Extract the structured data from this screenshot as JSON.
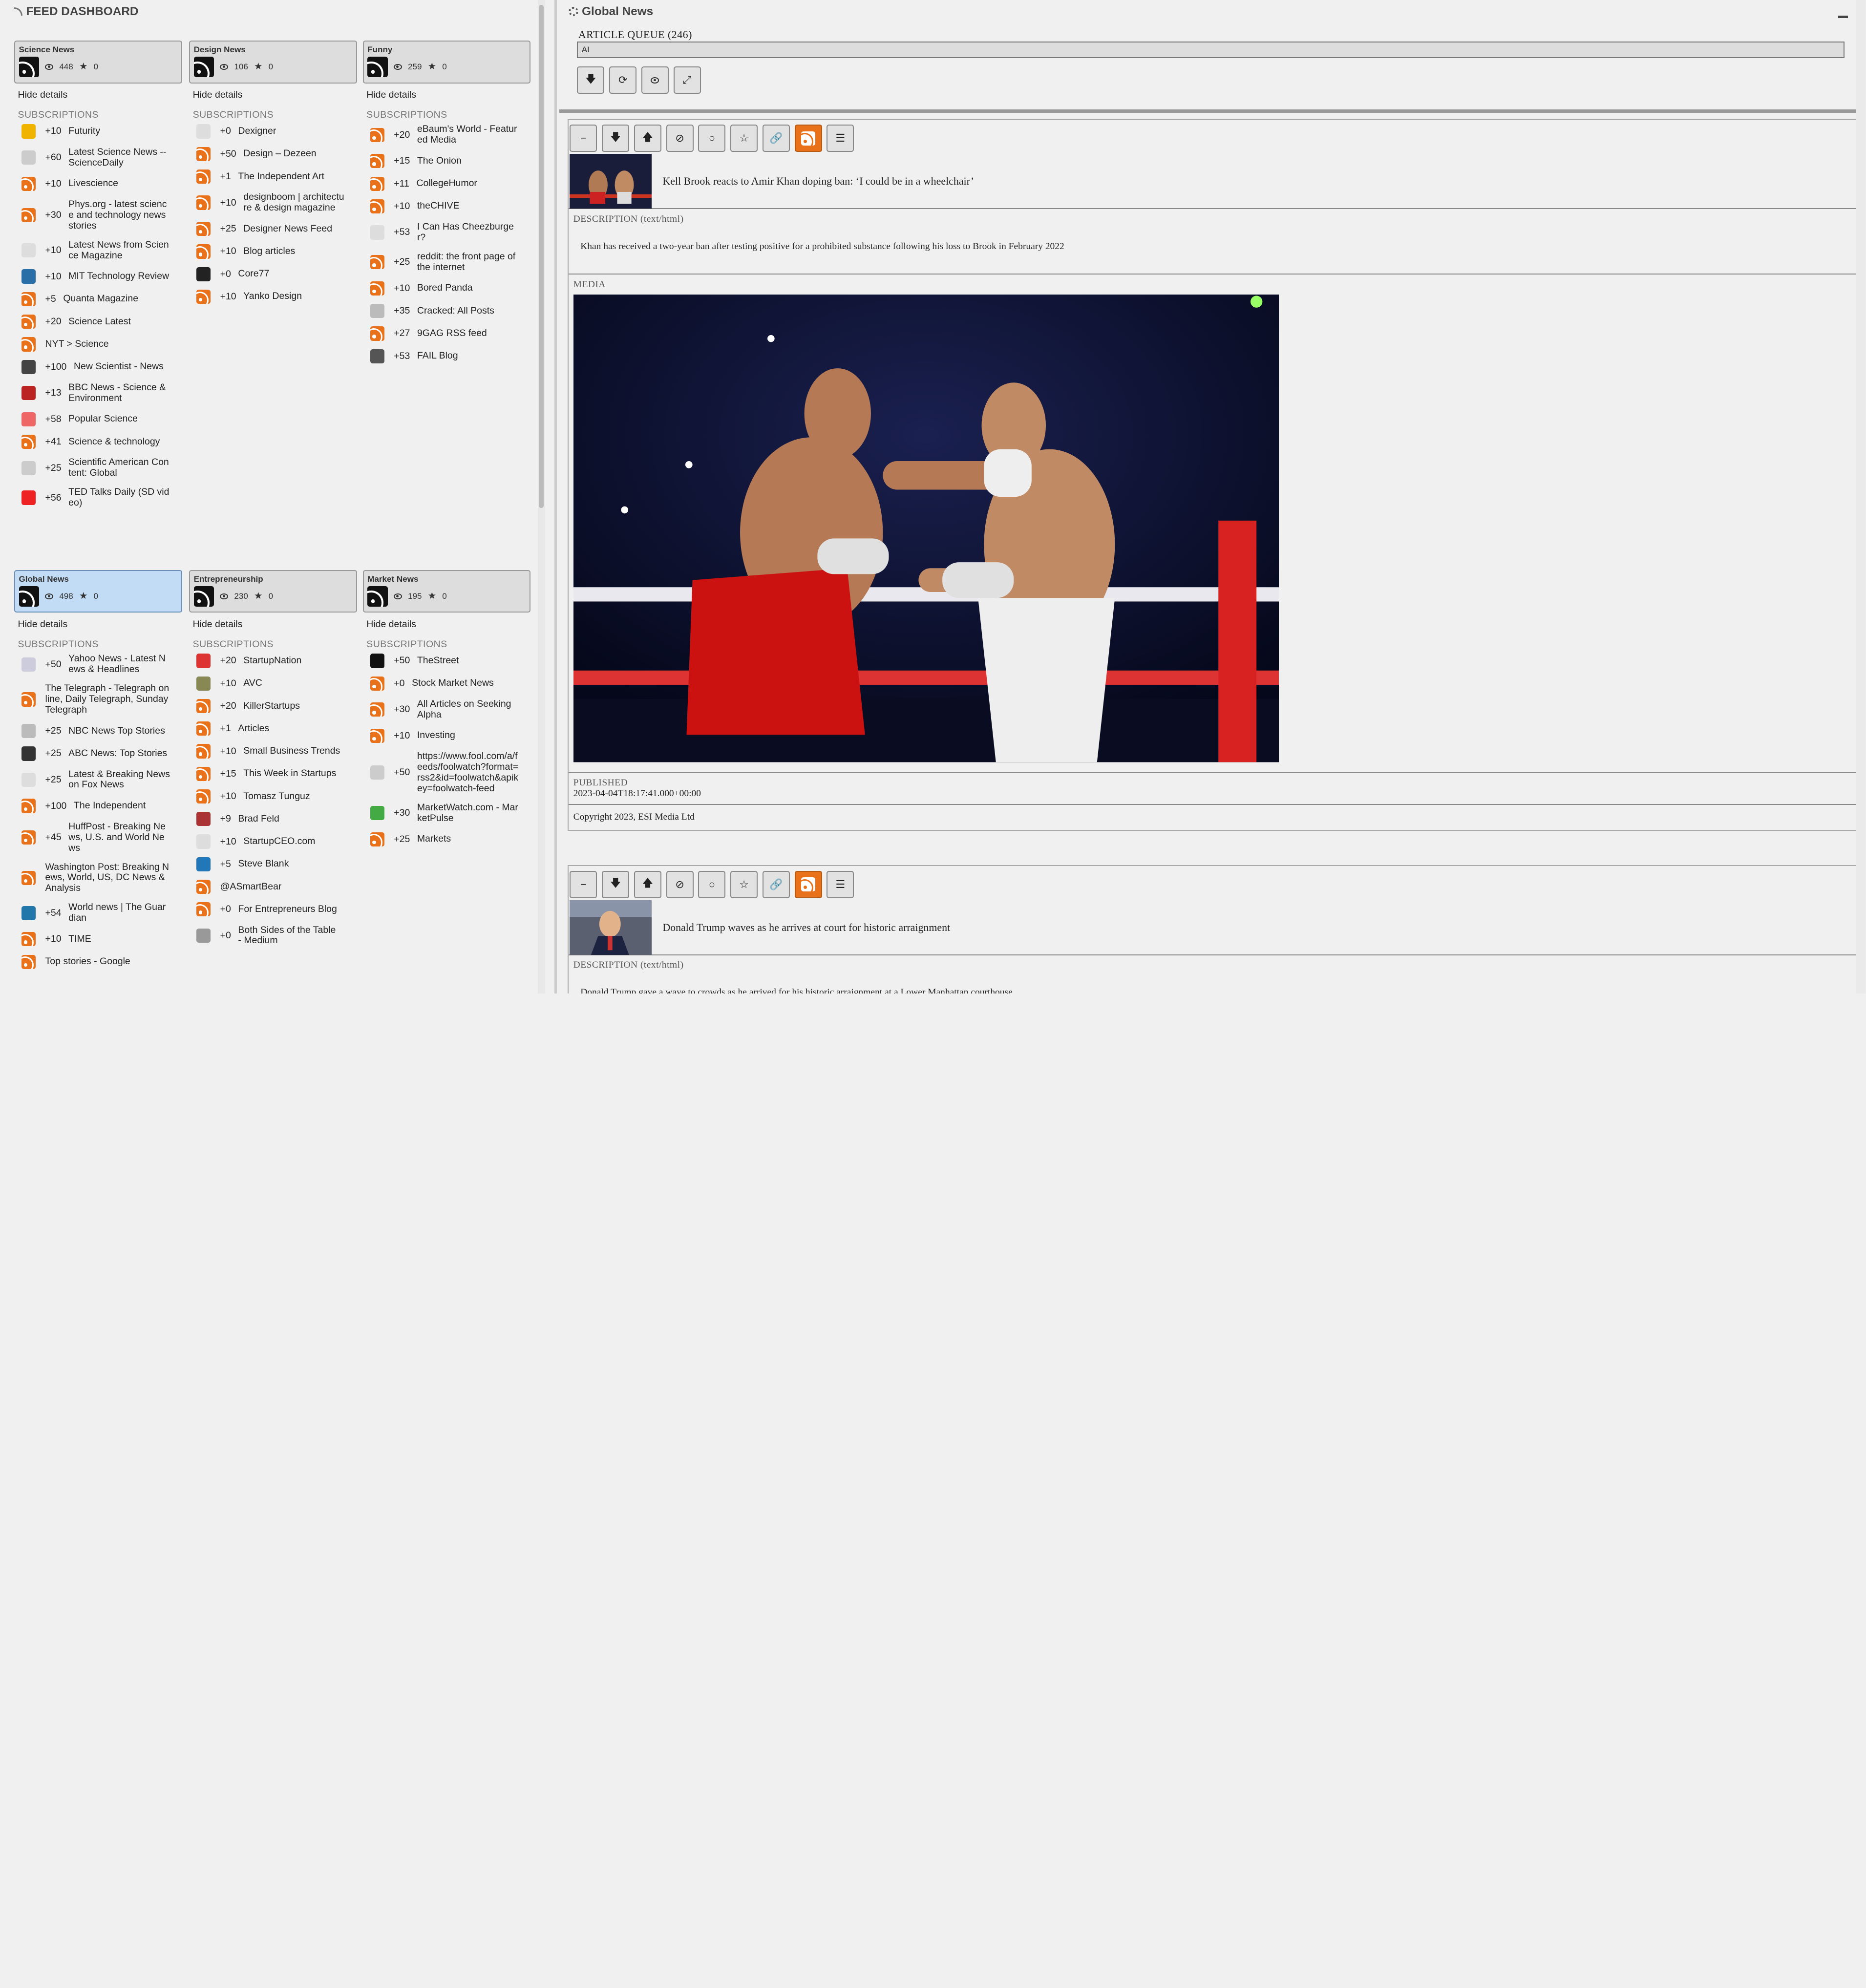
{
  "left": {
    "title": "FEED DASHBOARD",
    "hide_label": "Hide details",
    "subs_header": "SUBSCRIPTIONS",
    "columns": [
      {
        "name": "Science News",
        "views": "448",
        "stars": "0",
        "selected": false,
        "subs": [
          {
            "count": "+10",
            "name": "Futurity",
            "icon": "futurity-icon"
          },
          {
            "count": "+60",
            "name": "Latest Science News -- ScienceDaily",
            "icon": "sciencedaily-icon"
          },
          {
            "count": "+10",
            "name": "Livescience",
            "icon": "rss"
          },
          {
            "count": "+30",
            "name": "Phys.org - latest science and technology news stories",
            "icon": "rss"
          },
          {
            "count": "+10",
            "name": "Latest News from Science Magazine",
            "icon": "science-mag-icon"
          },
          {
            "count": "+10",
            "name": "MIT Technology Review",
            "icon": "mit-icon"
          },
          {
            "count": "+5",
            "name": "Quanta Magazine",
            "icon": "rss"
          },
          {
            "count": "+20",
            "name": "Science Latest",
            "icon": "rss"
          },
          {
            "count": "",
            "name": "NYT > Science",
            "icon": "rss"
          },
          {
            "count": "+100",
            "name": "New Scientist - News",
            "icon": "newscientist-icon"
          },
          {
            "count": "+13",
            "name": "BBC News - Science & Environment",
            "icon": "bbc-icon"
          },
          {
            "count": "+58",
            "name": "Popular Science",
            "icon": "popsci-icon"
          },
          {
            "count": "+41",
            "name": "Science & technology",
            "icon": "rss"
          },
          {
            "count": "+25",
            "name": "Scientific American Content: Global",
            "icon": "sciam-icon"
          },
          {
            "count": "+56",
            "name": "TED Talks Daily (SD video)",
            "icon": "ted-icon"
          }
        ]
      },
      {
        "name": "Design News",
        "views": "106",
        "stars": "0",
        "selected": false,
        "subs": [
          {
            "count": "+0",
            "name": "Dexigner",
            "icon": "dexigner-icon"
          },
          {
            "count": "+50",
            "name": "Design – Dezeen",
            "icon": "rss"
          },
          {
            "count": "+1",
            "name": "The Independent Art",
            "icon": "rss"
          },
          {
            "count": "+10",
            "name": "designboom | architecture & design magazine",
            "icon": "rss"
          },
          {
            "count": "+25",
            "name": "Designer News Feed",
            "icon": "rss"
          },
          {
            "count": "+10",
            "name": "Blog articles",
            "icon": "rss"
          },
          {
            "count": "+0",
            "name": "Core77",
            "icon": "core77-icon"
          },
          {
            "count": "+10",
            "name": "Yanko Design",
            "icon": "rss"
          }
        ]
      },
      {
        "name": "Funny",
        "views": "259",
        "stars": "0",
        "selected": false,
        "subs": [
          {
            "count": "+20",
            "name": "eBaum's World - Featured Media",
            "icon": "rss"
          },
          {
            "count": "+15",
            "name": "The Onion",
            "icon": "rss"
          },
          {
            "count": "+11",
            "name": "CollegeHumor",
            "icon": "rss"
          },
          {
            "count": "+10",
            "name": "theCHIVE",
            "icon": "rss"
          },
          {
            "count": "+53",
            "name": "I Can Has Cheezburger?",
            "icon": "cheezburger-icon"
          },
          {
            "count": "+25",
            "name": "reddit: the front page of the internet",
            "icon": "rss"
          },
          {
            "count": "+10",
            "name": "Bored Panda",
            "icon": "rss"
          },
          {
            "count": "+35",
            "name": "Cracked: All Posts",
            "icon": "cracked-icon"
          },
          {
            "count": "+27",
            "name": "9GAG RSS feed",
            "icon": "rss"
          },
          {
            "count": "+53",
            "name": "FAIL Blog",
            "icon": "failblog-icon"
          }
        ]
      },
      {
        "name": "Global News",
        "views": "498",
        "stars": "0",
        "selected": true,
        "subs": [
          {
            "count": "+50",
            "name": "Yahoo News - Latest News & Headlines",
            "icon": "yahoo-icon"
          },
          {
            "count": "",
            "name": "The Telegraph - Telegraph online, Daily Telegraph, Sunday Telegraph",
            "icon": "rss"
          },
          {
            "count": "+25",
            "name": "NBC News Top Stories",
            "icon": "nbc-icon"
          },
          {
            "count": "+25",
            "name": "ABC News: Top Stories",
            "icon": "abc-icon"
          },
          {
            "count": "+25",
            "name": "Latest & Breaking News on Fox News",
            "icon": "fox-icon"
          },
          {
            "count": "+100",
            "name": "The Independent",
            "icon": "rss"
          },
          {
            "count": "+45",
            "name": "HuffPost - Breaking News, U.S. and World News",
            "icon": "rss"
          },
          {
            "count": "",
            "name": "Washington Post: Breaking News, World, US, DC News & Analysis",
            "icon": "rss"
          },
          {
            "count": "+54",
            "name": "World news | The Guardian",
            "icon": "guardian-icon"
          },
          {
            "count": "+10",
            "name": "TIME",
            "icon": "rss"
          },
          {
            "count": "",
            "name": "Top stories - Google",
            "icon": "rss"
          }
        ]
      },
      {
        "name": "Entrepreneurship",
        "views": "230",
        "stars": "0",
        "selected": false,
        "subs": [
          {
            "count": "+20",
            "name": "StartupNation",
            "icon": "startupnation-icon"
          },
          {
            "count": "+10",
            "name": "AVC",
            "icon": "avc-icon"
          },
          {
            "count": "+20",
            "name": "KillerStartups",
            "icon": "rss"
          },
          {
            "count": "+1",
            "name": "Articles",
            "icon": "rss"
          },
          {
            "count": "+10",
            "name": "Small Business Trends",
            "icon": "rss"
          },
          {
            "count": "+15",
            "name": "This Week in Startups",
            "icon": "rss"
          },
          {
            "count": "+10",
            "name": "Tomasz Tunguz",
            "icon": "rss"
          },
          {
            "count": "+9",
            "name": "Brad Feld",
            "icon": "bradfeld-icon"
          },
          {
            "count": "+10",
            "name": "StartupCEO.com",
            "icon": "startupceo-icon"
          },
          {
            "count": "+5",
            "name": "Steve Blank",
            "icon": "wordpress-icon"
          },
          {
            "count": "",
            "name": "@ASmartBear",
            "icon": "rss"
          },
          {
            "count": "+0",
            "name": "For Entrepreneurs Blog",
            "icon": "rss"
          },
          {
            "count": "+0",
            "name": "Both Sides of the Table - Medium",
            "icon": "medium-icon"
          }
        ]
      },
      {
        "name": "Market News",
        "views": "195",
        "stars": "0",
        "selected": false,
        "subs": [
          {
            "count": "+50",
            "name": "TheStreet",
            "icon": "thestreet-icon"
          },
          {
            "count": "+0",
            "name": "Stock Market News",
            "icon": "rss"
          },
          {
            "count": "+30",
            "name": "All Articles on Seeking Alpha",
            "icon": "rss"
          },
          {
            "count": "+10",
            "name": "Investing",
            "icon": "rss"
          },
          {
            "count": "+50",
            "name": "https://www.fool.com/a/feeds/foolwatch?format=rss2&id=foolwatch&apikey=foolwatch-feed",
            "icon": "fool-icon"
          },
          {
            "count": "+30",
            "name": "MarketWatch.com - MarketPulse",
            "icon": "marketwatch-icon"
          },
          {
            "count": "+25",
            "name": "Markets",
            "icon": "rss"
          }
        ]
      }
    ]
  },
  "right": {
    "title": "Global News",
    "queue_label": "ARTICLE QUEUE (246)",
    "queue_filter": "AI",
    "articles": [
      {
        "title": "Kell Brook reacts to Amir Khan doping ban: ‘I could be in a wheelchair’",
        "desc_label": "DESCRIPTION (text/html)",
        "desc": "Khan has received a two-year ban after testing positive for a prohibited substance following his loss to Brook in February 2022",
        "media_label": "MEDIA",
        "published_label": "PUBLISHED",
        "published": "2023-04-04T18:17:41.000+00:00",
        "copyright": "Copyright 2023, ESI Media Ltd"
      },
      {
        "title": "Donald Trump waves as he arrives at court for historic arraignment",
        "desc_label": "DESCRIPTION (text/html)",
        "desc": "Donald Trump gave a wave to crowds as he arrived for his historic arraignment at a Lower Manhattan courthouse"
      }
    ]
  },
  "colors": {
    "accent": "#e8711a",
    "selected": "#c2dcf5",
    "card": "#dddddd",
    "background": "#f0f0f0"
  }
}
